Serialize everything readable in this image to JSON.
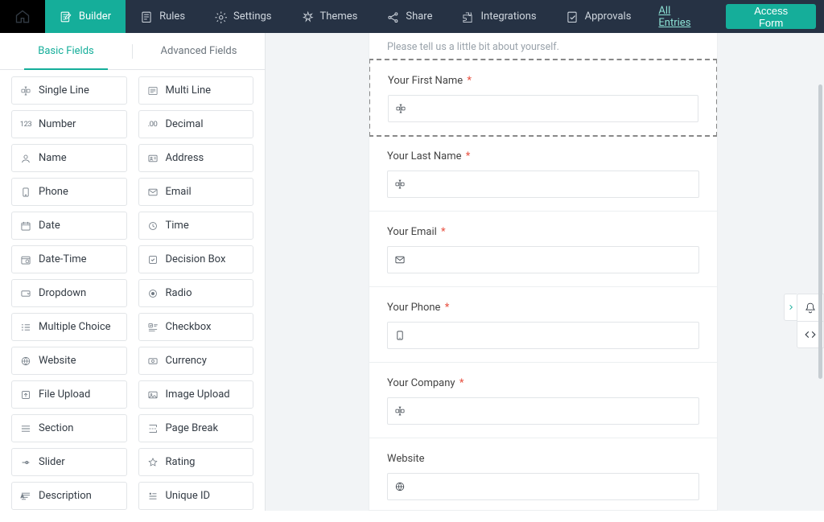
{
  "nav": {
    "items": [
      {
        "key": "builder",
        "label": "Builder",
        "icon": "form",
        "active": true
      },
      {
        "key": "rules",
        "label": "Rules",
        "icon": "rules"
      },
      {
        "key": "settings",
        "label": "Settings",
        "icon": "gear"
      },
      {
        "key": "themes",
        "label": "Themes",
        "icon": "themes"
      },
      {
        "key": "share",
        "label": "Share",
        "icon": "share"
      },
      {
        "key": "integrations",
        "label": "Integrations",
        "icon": "puzzle"
      },
      {
        "key": "approvals",
        "label": "Approvals",
        "icon": "approve"
      }
    ],
    "all_entries": "All Entries",
    "access_form": "Access Form"
  },
  "sidebar": {
    "tabs": {
      "basic": "Basic Fields",
      "advanced": "Advanced Fields",
      "active": "basic"
    },
    "fields": [
      [
        {
          "k": "single-line",
          "label": "Single Line",
          "icon": "text-cursor"
        },
        {
          "k": "multi-line",
          "label": "Multi Line",
          "icon": "multiline"
        }
      ],
      [
        {
          "k": "number",
          "label": "Number",
          "icon": "t123",
          "t": "123"
        },
        {
          "k": "decimal",
          "label": "Decimal",
          "icon": "t123",
          "t": ".00"
        }
      ],
      [
        {
          "k": "name",
          "label": "Name",
          "icon": "user"
        },
        {
          "k": "address",
          "label": "Address",
          "icon": "id"
        }
      ],
      [
        {
          "k": "phone",
          "label": "Phone",
          "icon": "phone"
        },
        {
          "k": "email",
          "label": "Email",
          "icon": "mail"
        }
      ],
      [
        {
          "k": "date",
          "label": "Date",
          "icon": "calendar"
        },
        {
          "k": "time",
          "label": "Time",
          "icon": "clock"
        }
      ],
      [
        {
          "k": "date-time",
          "label": "Date-Time",
          "icon": "calendar2"
        },
        {
          "k": "decision",
          "label": "Decision Box",
          "icon": "checkbox"
        }
      ],
      [
        {
          "k": "dropdown",
          "label": "Dropdown",
          "icon": "dropdown"
        },
        {
          "k": "radio",
          "label": "Radio",
          "icon": "radio"
        }
      ],
      [
        {
          "k": "multi-choice",
          "label": "Multiple Choice",
          "icon": "choices"
        },
        {
          "k": "checkbox",
          "label": "Checkbox",
          "icon": "checkbox2"
        }
      ],
      [
        {
          "k": "website",
          "label": "Website",
          "icon": "globe"
        },
        {
          "k": "currency",
          "label": "Currency",
          "icon": "currency"
        }
      ],
      [
        {
          "k": "file-upload",
          "label": "File Upload",
          "icon": "upload"
        },
        {
          "k": "image-upload",
          "label": "Image Upload",
          "icon": "imgup"
        }
      ],
      [
        {
          "k": "section",
          "label": "Section",
          "icon": "section"
        },
        {
          "k": "page-break",
          "label": "Page Break",
          "icon": "pagebreak"
        }
      ],
      [
        {
          "k": "slider",
          "label": "Slider",
          "icon": "slider"
        },
        {
          "k": "rating",
          "label": "Rating",
          "icon": "star"
        }
      ],
      [
        {
          "k": "description",
          "label": "Description",
          "icon": "desc"
        },
        {
          "k": "unique-id",
          "label": "Unique ID",
          "icon": "uid"
        }
      ]
    ]
  },
  "form": {
    "section_subtitle": "Please tell us a little bit about yourself.",
    "fields": [
      {
        "k": "first-name",
        "label": "Your First Name",
        "required": true,
        "icon": "text-cursor",
        "selected": true
      },
      {
        "k": "last-name",
        "label": "Your Last Name",
        "required": true,
        "icon": "text-cursor"
      },
      {
        "k": "email",
        "label": "Your Email",
        "required": true,
        "icon": "mail"
      },
      {
        "k": "phone",
        "label": "Your Phone",
        "required": true,
        "icon": "phone"
      },
      {
        "k": "company",
        "label": "Your Company",
        "required": true,
        "icon": "text-cursor"
      },
      {
        "k": "website",
        "label": "Website",
        "required": false,
        "icon": "globe"
      }
    ]
  }
}
